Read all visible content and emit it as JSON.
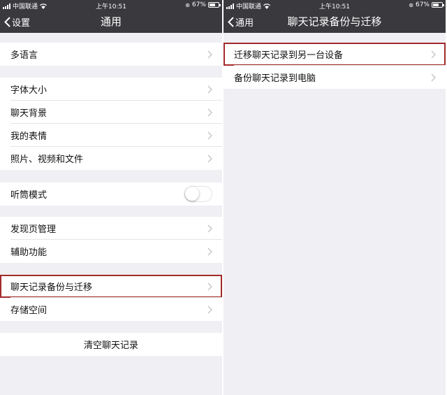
{
  "left": {
    "status": {
      "carrier": "中国联通",
      "time": "上午10:51",
      "battery": "67%",
      "battery_level": 0.67
    },
    "nav": {
      "back_label": "设置",
      "title": "通用"
    },
    "groups": [
      {
        "items": [
          "多语言"
        ]
      },
      {
        "items": [
          "字体大小",
          "聊天背景",
          "我的表情",
          "照片、视频和文件"
        ]
      },
      {
        "items": [
          "听筒模式"
        ]
      },
      {
        "items": [
          "发现页管理",
          "辅助功能"
        ]
      },
      {
        "items": [
          "聊天记录备份与迁移",
          "存储空间"
        ]
      },
      {
        "items": [
          "清空聊天记录"
        ]
      }
    ],
    "toggle_earpiece_on": false
  },
  "right": {
    "status": {
      "carrier": "中国联通",
      "time": "上午10:51",
      "battery": "67%",
      "battery_level": 0.67
    },
    "nav": {
      "back_label": "通用",
      "title": "聊天记录备份与迁移"
    },
    "items": [
      "迁移聊天记录到另一台设备",
      "备份聊天记录到电脑"
    ]
  },
  "colors": {
    "nav_bg": "#39393e",
    "page_bg": "#efeff4",
    "highlight": "#a22a2a",
    "chevron": "#c7c7cc"
  },
  "icons": {
    "back": "chevron-left-icon",
    "row_arrow": "chevron-right-icon",
    "signal": "signal-icon",
    "wifi": "wifi-icon",
    "lock": "orientation-lock-icon",
    "battery": "battery-icon"
  }
}
